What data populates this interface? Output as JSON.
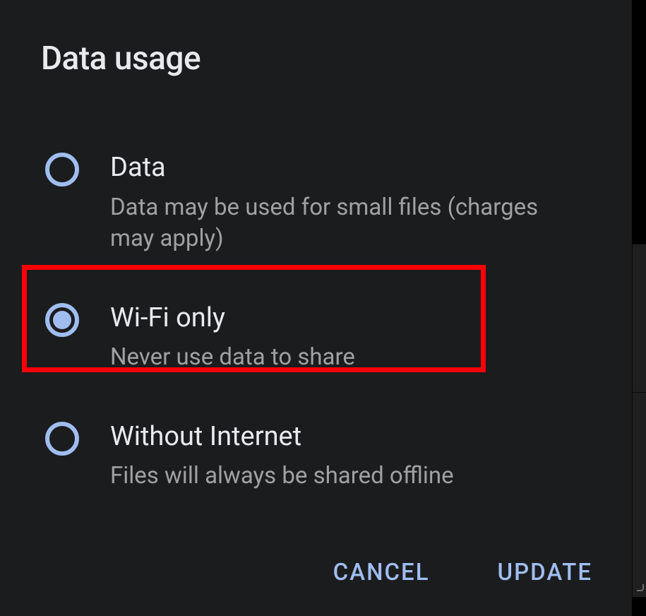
{
  "dialog": {
    "title": "Data usage",
    "options": [
      {
        "label": "Data",
        "desc": "Data may be used for small files (charges may apply)",
        "selected": false
      },
      {
        "label": "Wi-Fi only",
        "desc": "Never use data to share",
        "selected": true
      },
      {
        "label": "Without Internet",
        "desc": "Files will always be shared offline",
        "selected": false
      }
    ],
    "buttons": {
      "cancel": "CANCEL",
      "update": "UPDATE"
    }
  },
  "annotation": {
    "highlighted_option_index": 1
  }
}
